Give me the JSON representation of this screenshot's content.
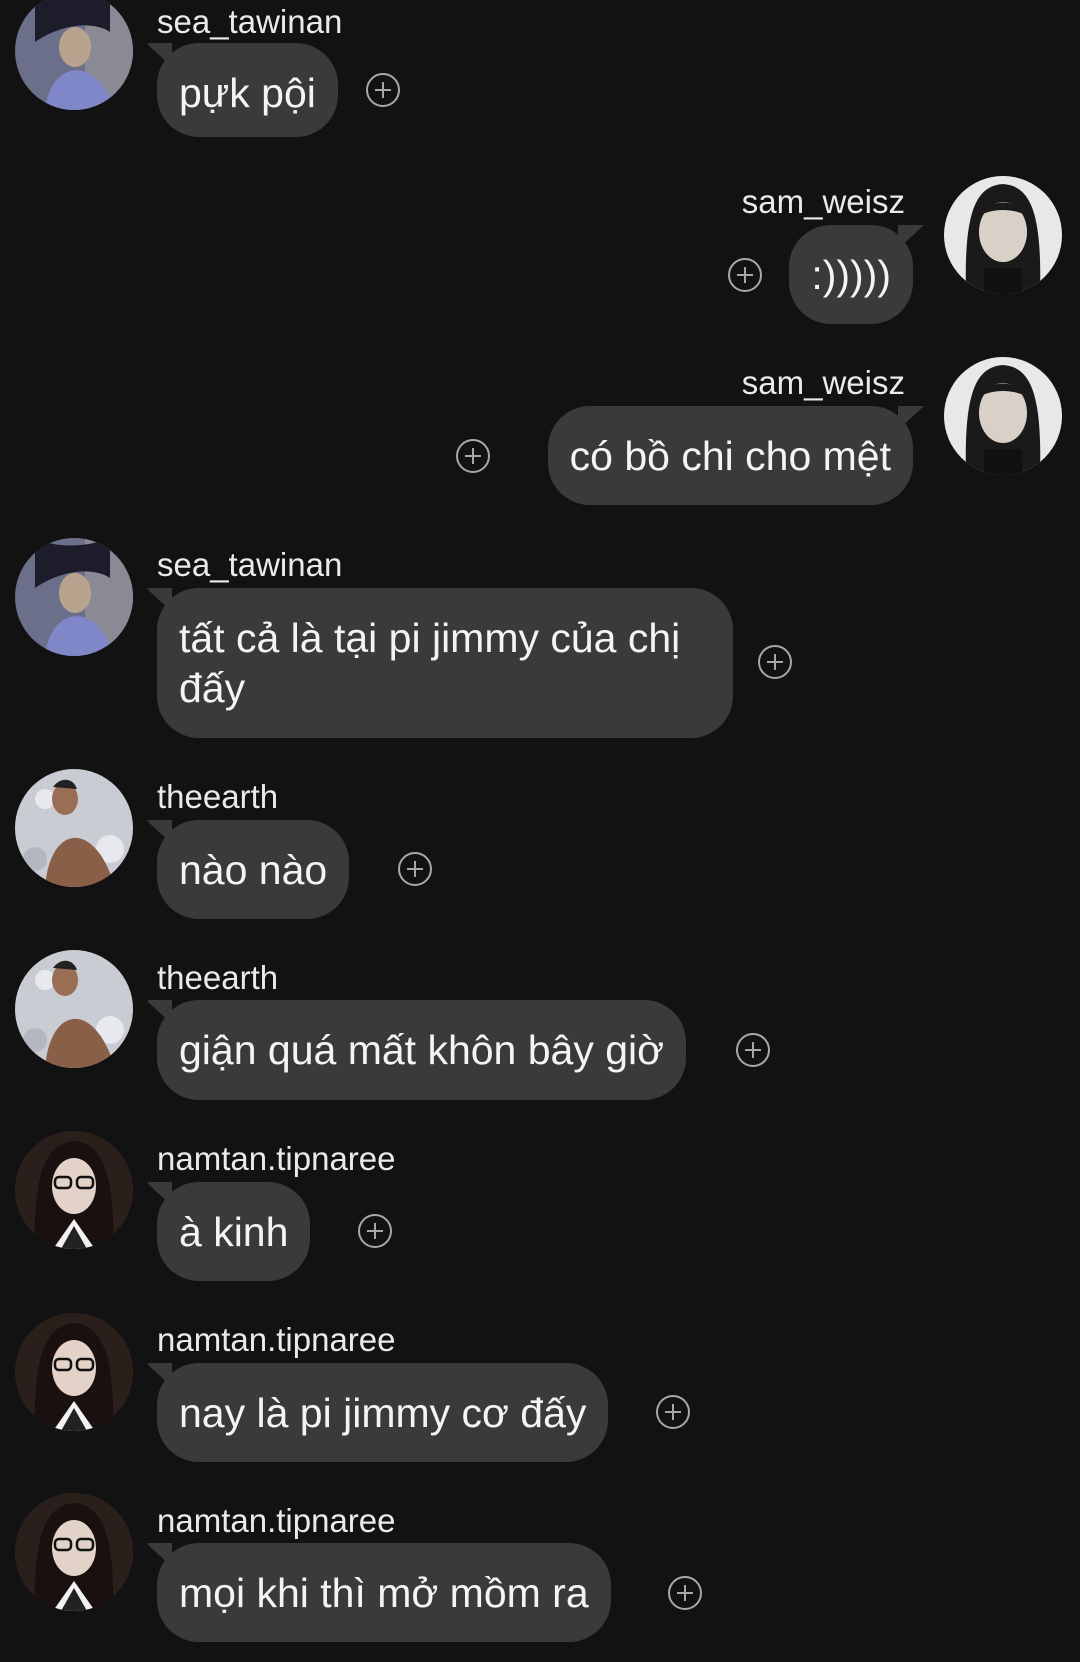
{
  "messages": [
    {
      "user": "sea_tawinan",
      "text": "pựk pội"
    },
    {
      "user": "sam_weisz",
      "text": ":)))))"
    },
    {
      "user": "sam_weisz",
      "text": "có bồ chi cho mệt"
    },
    {
      "user": "sea_tawinan",
      "text": "tất cả là tại pi jimmy của chị đấy"
    },
    {
      "user": "theearth",
      "text": "nào nào"
    },
    {
      "user": "theearth",
      "text": "giận quá mất khôn bây giờ"
    },
    {
      "user": "namtan.tipnaree",
      "text": "à kinh"
    },
    {
      "user": "namtan.tipnaree",
      "text": "nay là pi jimmy cơ đấy"
    },
    {
      "user": "namtan.tipnaree",
      "text": "mọi khi thì mở mồm ra"
    }
  ],
  "icons": {
    "react": "add-reaction-icon",
    "avatar": "avatar"
  },
  "colors": {
    "background": "#121212",
    "bubble": "#3a3a3c",
    "text": "#f4f4f4",
    "icon": "#a8a8a8"
  }
}
